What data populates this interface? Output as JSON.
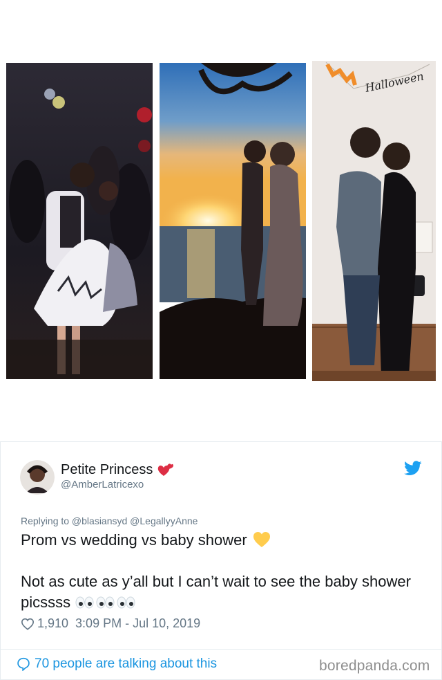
{
  "photos": [
    {
      "name": "prom photo"
    },
    {
      "name": "wedding photo"
    },
    {
      "name": "baby shower photo",
      "banner_text": "Happy Halloween"
    }
  ],
  "tweet": {
    "display_name": "Petite Princess",
    "handle": "@AmberLatricexo",
    "reply_line": "Replying to @blasiansyd @LegallyyAnne",
    "line1": "Prom vs wedding vs baby shower",
    "line2": "Not as cute as y’all but I can’t wait to see the baby shower picssss",
    "likes": "1,910",
    "timestamp": "3:09 PM - Jul 10, 2019",
    "talking": "70 people are talking about this"
  },
  "watermark": "boredpanda.com",
  "colors": {
    "accent": "#1b95e0",
    "muted": "#657786",
    "text": "#14171a"
  }
}
